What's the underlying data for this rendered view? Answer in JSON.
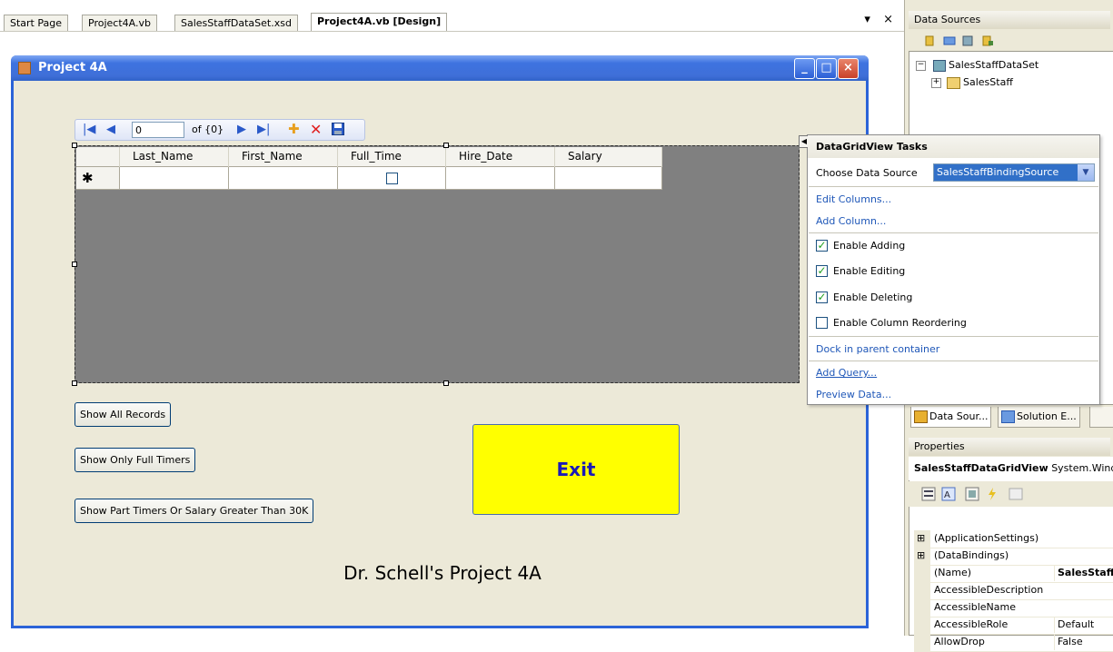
{
  "tabs": [
    {
      "label": "Start Page"
    },
    {
      "label": "Project4A.vb"
    },
    {
      "label": "SalesStaffDataSet.xsd"
    },
    {
      "label": "Project4A.vb [Design]"
    }
  ],
  "tab_controls": {
    "dropdown": "▾",
    "close": "×"
  },
  "form": {
    "title": "Project 4A",
    "title_buttons": {
      "minimize": "_",
      "maximize": "□",
      "close": "×"
    },
    "navigator": {
      "position": "0",
      "count_label": "of {0}"
    },
    "grid": {
      "columns": [
        "Last_Name",
        "First_Name",
        "Full_Time",
        "Hire_Date",
        "Salary"
      ],
      "new_row_marker": "✱"
    },
    "buttons": {
      "show_all": "Show All Records",
      "show_full": "Show Only Full Timers",
      "show_part": "Show Part Timers Or Salary Greater Than 30K",
      "exit": "Exit"
    },
    "label": "Dr. Schell's Project 4A"
  },
  "smart_tag": {
    "title": "DataGridView Tasks",
    "choose_label": "Choose Data Source",
    "choose_value": "SalesStaffBindingSource",
    "edit_columns": "Edit Columns...",
    "add_column": "Add Column...",
    "options": [
      {
        "label": "Enable Adding",
        "checked": true
      },
      {
        "label": "Enable Editing",
        "checked": true
      },
      {
        "label": "Enable Deleting",
        "checked": true
      },
      {
        "label": "Enable Column Reordering",
        "checked": false
      }
    ],
    "dock": "Dock in parent container",
    "add_query": "Add Query...",
    "preview": "Preview Data..."
  },
  "data_sources": {
    "title": "Data Sources",
    "tree": [
      {
        "label": "SalesStaffDataSet",
        "expander": "⊟"
      },
      {
        "label": "SalesStaff",
        "expander": "⊞"
      }
    ],
    "bottom_tabs": [
      "Data Sour...",
      "Solution E..."
    ]
  },
  "properties": {
    "title": "Properties",
    "object_name": "SalesStaffDataGridView",
    "object_type": "System.Windows.Forms.DataGridView",
    "rows": [
      {
        "name": "(ApplicationSettings)",
        "value": "",
        "expander": "⊞"
      },
      {
        "name": "(DataBindings)",
        "value": "",
        "expander": "⊞"
      },
      {
        "name": "(Name)",
        "value": "SalesStaffDataGridView",
        "expander": ""
      },
      {
        "name": "AccessibleDescription",
        "value": "",
        "expander": ""
      },
      {
        "name": "AccessibleName",
        "value": "",
        "expander": ""
      },
      {
        "name": "AccessibleRole",
        "value": "Default",
        "expander": ""
      },
      {
        "name": "AllowDrop",
        "value": "False",
        "expander": ""
      }
    ]
  },
  "colors": {
    "accent": "#2b63d8",
    "exit_bg": "#ffff00",
    "exit_text": "#1a1ab8",
    "link": "#1f57b8"
  }
}
